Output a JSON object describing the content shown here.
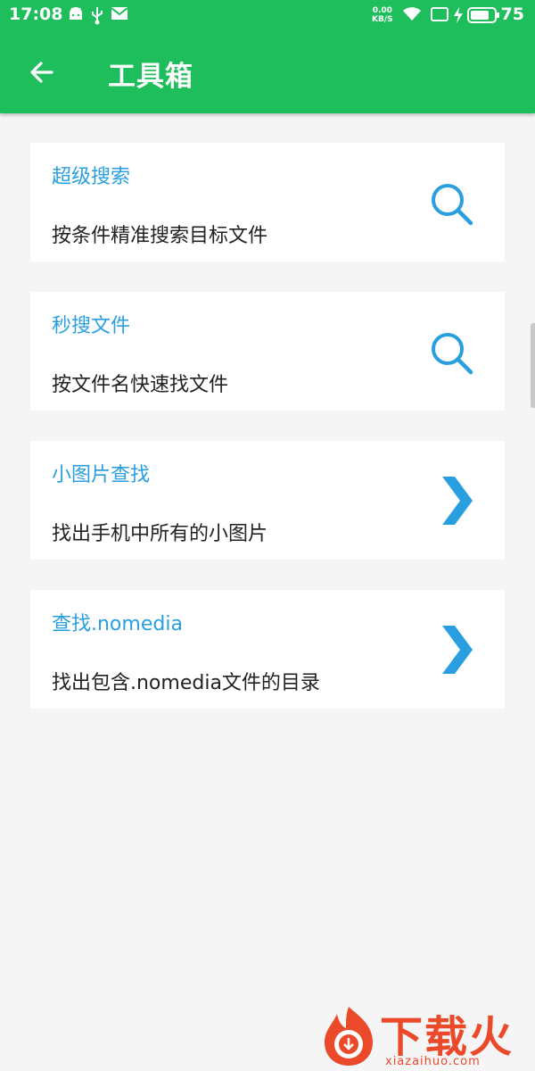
{
  "status_bar": {
    "time": "17:08",
    "net_speed_value": "0.00",
    "net_speed_unit": "KB/S",
    "battery": "75"
  },
  "toolbar": {
    "title": "工具箱"
  },
  "cards": [
    {
      "title": "超级搜索",
      "description": "按条件精准搜索目标文件",
      "icon": "search-icon"
    },
    {
      "title": "秒搜文件",
      "description": "按文件名快速找文件",
      "icon": "search-icon"
    },
    {
      "title": "小图片查找",
      "description": "找出手机中所有的小图片",
      "icon": "chevron-right-icon"
    },
    {
      "title": "查找.nomedia",
      "description": "找出包含.nomedia文件的目录",
      "icon": "chevron-right-icon"
    }
  ],
  "watermark": {
    "brand": "下载火",
    "domain": "xiazaihuo.com"
  },
  "colors": {
    "header": "#1fbe5c",
    "accent": "#2a9fe0",
    "background": "#f5f5f5"
  }
}
